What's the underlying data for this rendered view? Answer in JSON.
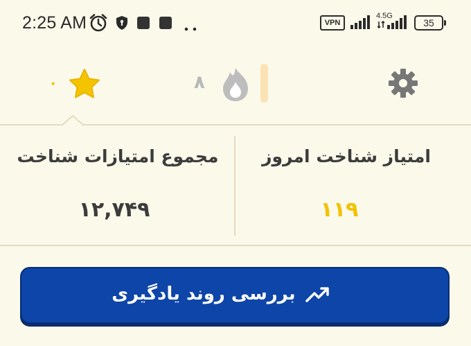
{
  "status_bar": {
    "time": "2:25 AM",
    "vpn_label": "VPN",
    "network_type": "4.5G",
    "battery_level": "35",
    "icons": [
      "alarm-icon",
      "shield-icon",
      "notification-icon",
      "notification-icon",
      "more-dots-icon",
      "signal-icon",
      "signal-icon"
    ]
  },
  "top_bar": {
    "star_count": "۰",
    "streak_count": "۸",
    "icons": [
      "star-icon",
      "flame-icon",
      "settings-icon"
    ]
  },
  "stats": {
    "total_label": "مجموع امتیازات شناخت",
    "total_value": "۱۲,۷۴۹",
    "today_label": "امتیاز شناخت امروز",
    "today_value": "۱۱۹"
  },
  "cta": {
    "label": "بررسی روند یادگیری",
    "icon": "trending-up-icon"
  },
  "colors": {
    "background": "#fbf9ea",
    "accent_yellow": "#f2c200",
    "button_blue": "#0e45a8",
    "divider": "#e4dbc1"
  }
}
